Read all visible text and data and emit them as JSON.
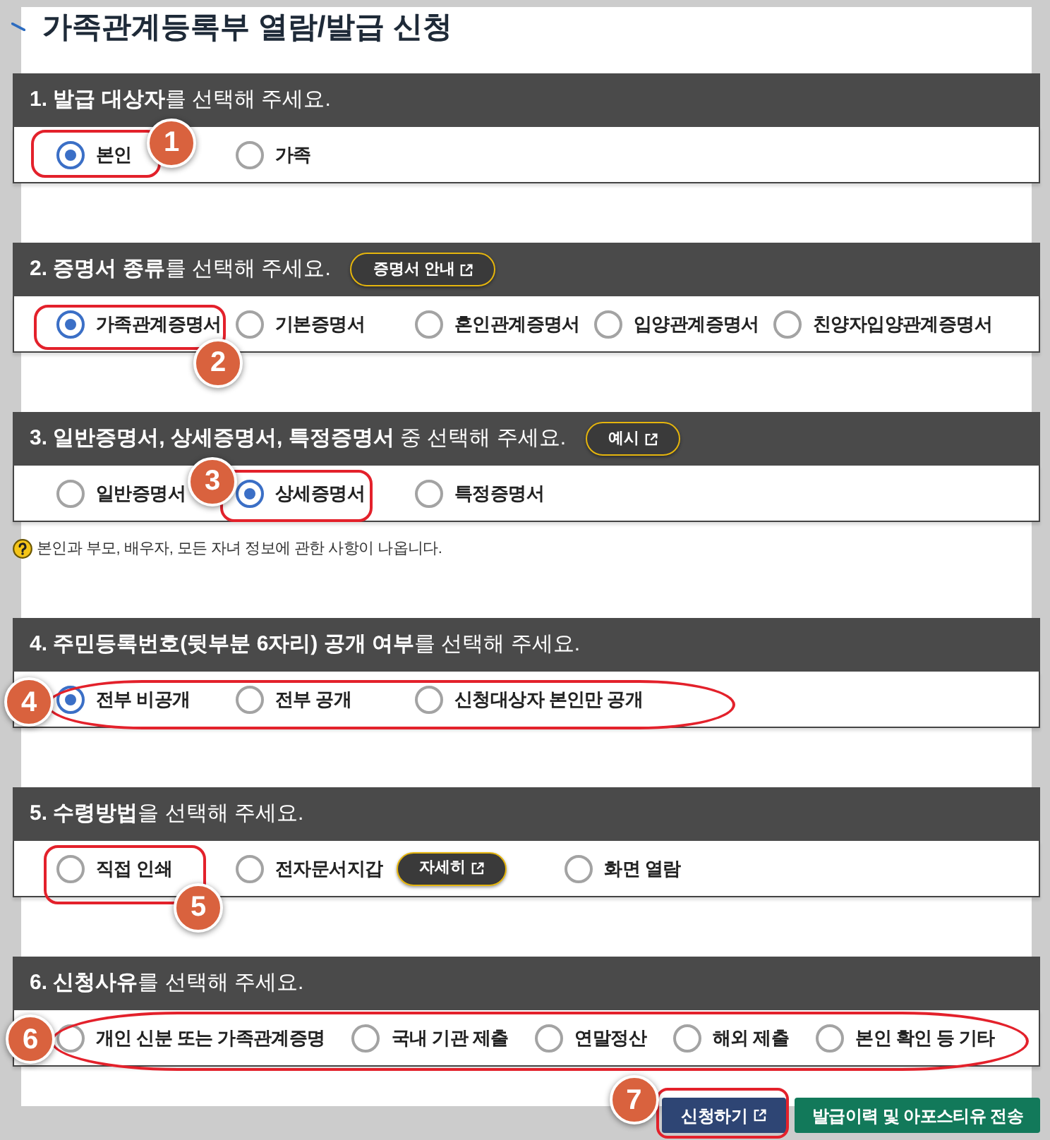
{
  "page": {
    "title": "가족관계등록부 열람/발급 신청"
  },
  "sections": [
    {
      "heading": "**1. 발급 대상자**를 선택해 주세요.",
      "options": [
        {
          "label": "본인",
          "selected": true,
          "callout": "1"
        },
        {
          "label": "가족",
          "selected": false
        }
      ]
    },
    {
      "heading": "**2. 증명서 종류**를 선택해 주세요.",
      "info_button": {
        "label": "증명서 안내",
        "external": true
      },
      "options": [
        {
          "label": "가족관계증명서",
          "selected": true,
          "callout": "2"
        },
        {
          "label": "기본증명서",
          "selected": false
        },
        {
          "label": "혼인관계증명서",
          "selected": false
        },
        {
          "label": "입양관계증명서",
          "selected": false
        },
        {
          "label": "친양자입양관계증명서",
          "selected": false
        }
      ]
    },
    {
      "heading": "**3. 일반증명서, 상세증명서, 특정증명서** 중 선택해 주세요.",
      "info_button": {
        "label": "예시",
        "external": true
      },
      "options": [
        {
          "label": "일반증명서",
          "selected": false
        },
        {
          "label": "상세증명서",
          "selected": true,
          "callout": "3"
        },
        {
          "label": "특정증명서",
          "selected": false
        }
      ],
      "note": "본인과 부모, 배우자, 모든 자녀 정보에 관한 사항이 나옵니다."
    },
    {
      "heading": "**4. 주민등록번호(뒷부분 6자리) 공개 여부**를 선택해 주세요.",
      "callout": "4",
      "options": [
        {
          "label": "전부 비공개",
          "selected": true
        },
        {
          "label": "전부 공개",
          "selected": false
        },
        {
          "label": "신청대상자 본인만 공개",
          "selected": false
        }
      ]
    },
    {
      "heading": "**5. 수령방법**을 선택해 주세요.",
      "options": [
        {
          "label": "직접 인쇄",
          "selected": false,
          "callout": "5"
        },
        {
          "label": "전자문서지갑",
          "selected": false,
          "info_button": {
            "label": "자세히",
            "external": true
          }
        },
        {
          "label": "화면 열람",
          "selected": false
        }
      ]
    },
    {
      "heading": "**6. 신청사유**를 선택해 주세요.",
      "callout": "6",
      "options": [
        {
          "label": "개인 신분 또는 가족관계증명",
          "selected": false
        },
        {
          "label": "국내 기관 제출",
          "selected": false
        },
        {
          "label": "연말정산",
          "selected": false
        },
        {
          "label": "해외 제출",
          "selected": false
        },
        {
          "label": "본인 확인 등 기타",
          "selected": false
        }
      ]
    }
  ],
  "actions": [
    {
      "label": "신청하기",
      "kind": "primary",
      "external": true,
      "callout": "7"
    },
    {
      "label": "발급이력 및 아포스티유 전송",
      "kind": "secondary",
      "external": false
    }
  ]
}
